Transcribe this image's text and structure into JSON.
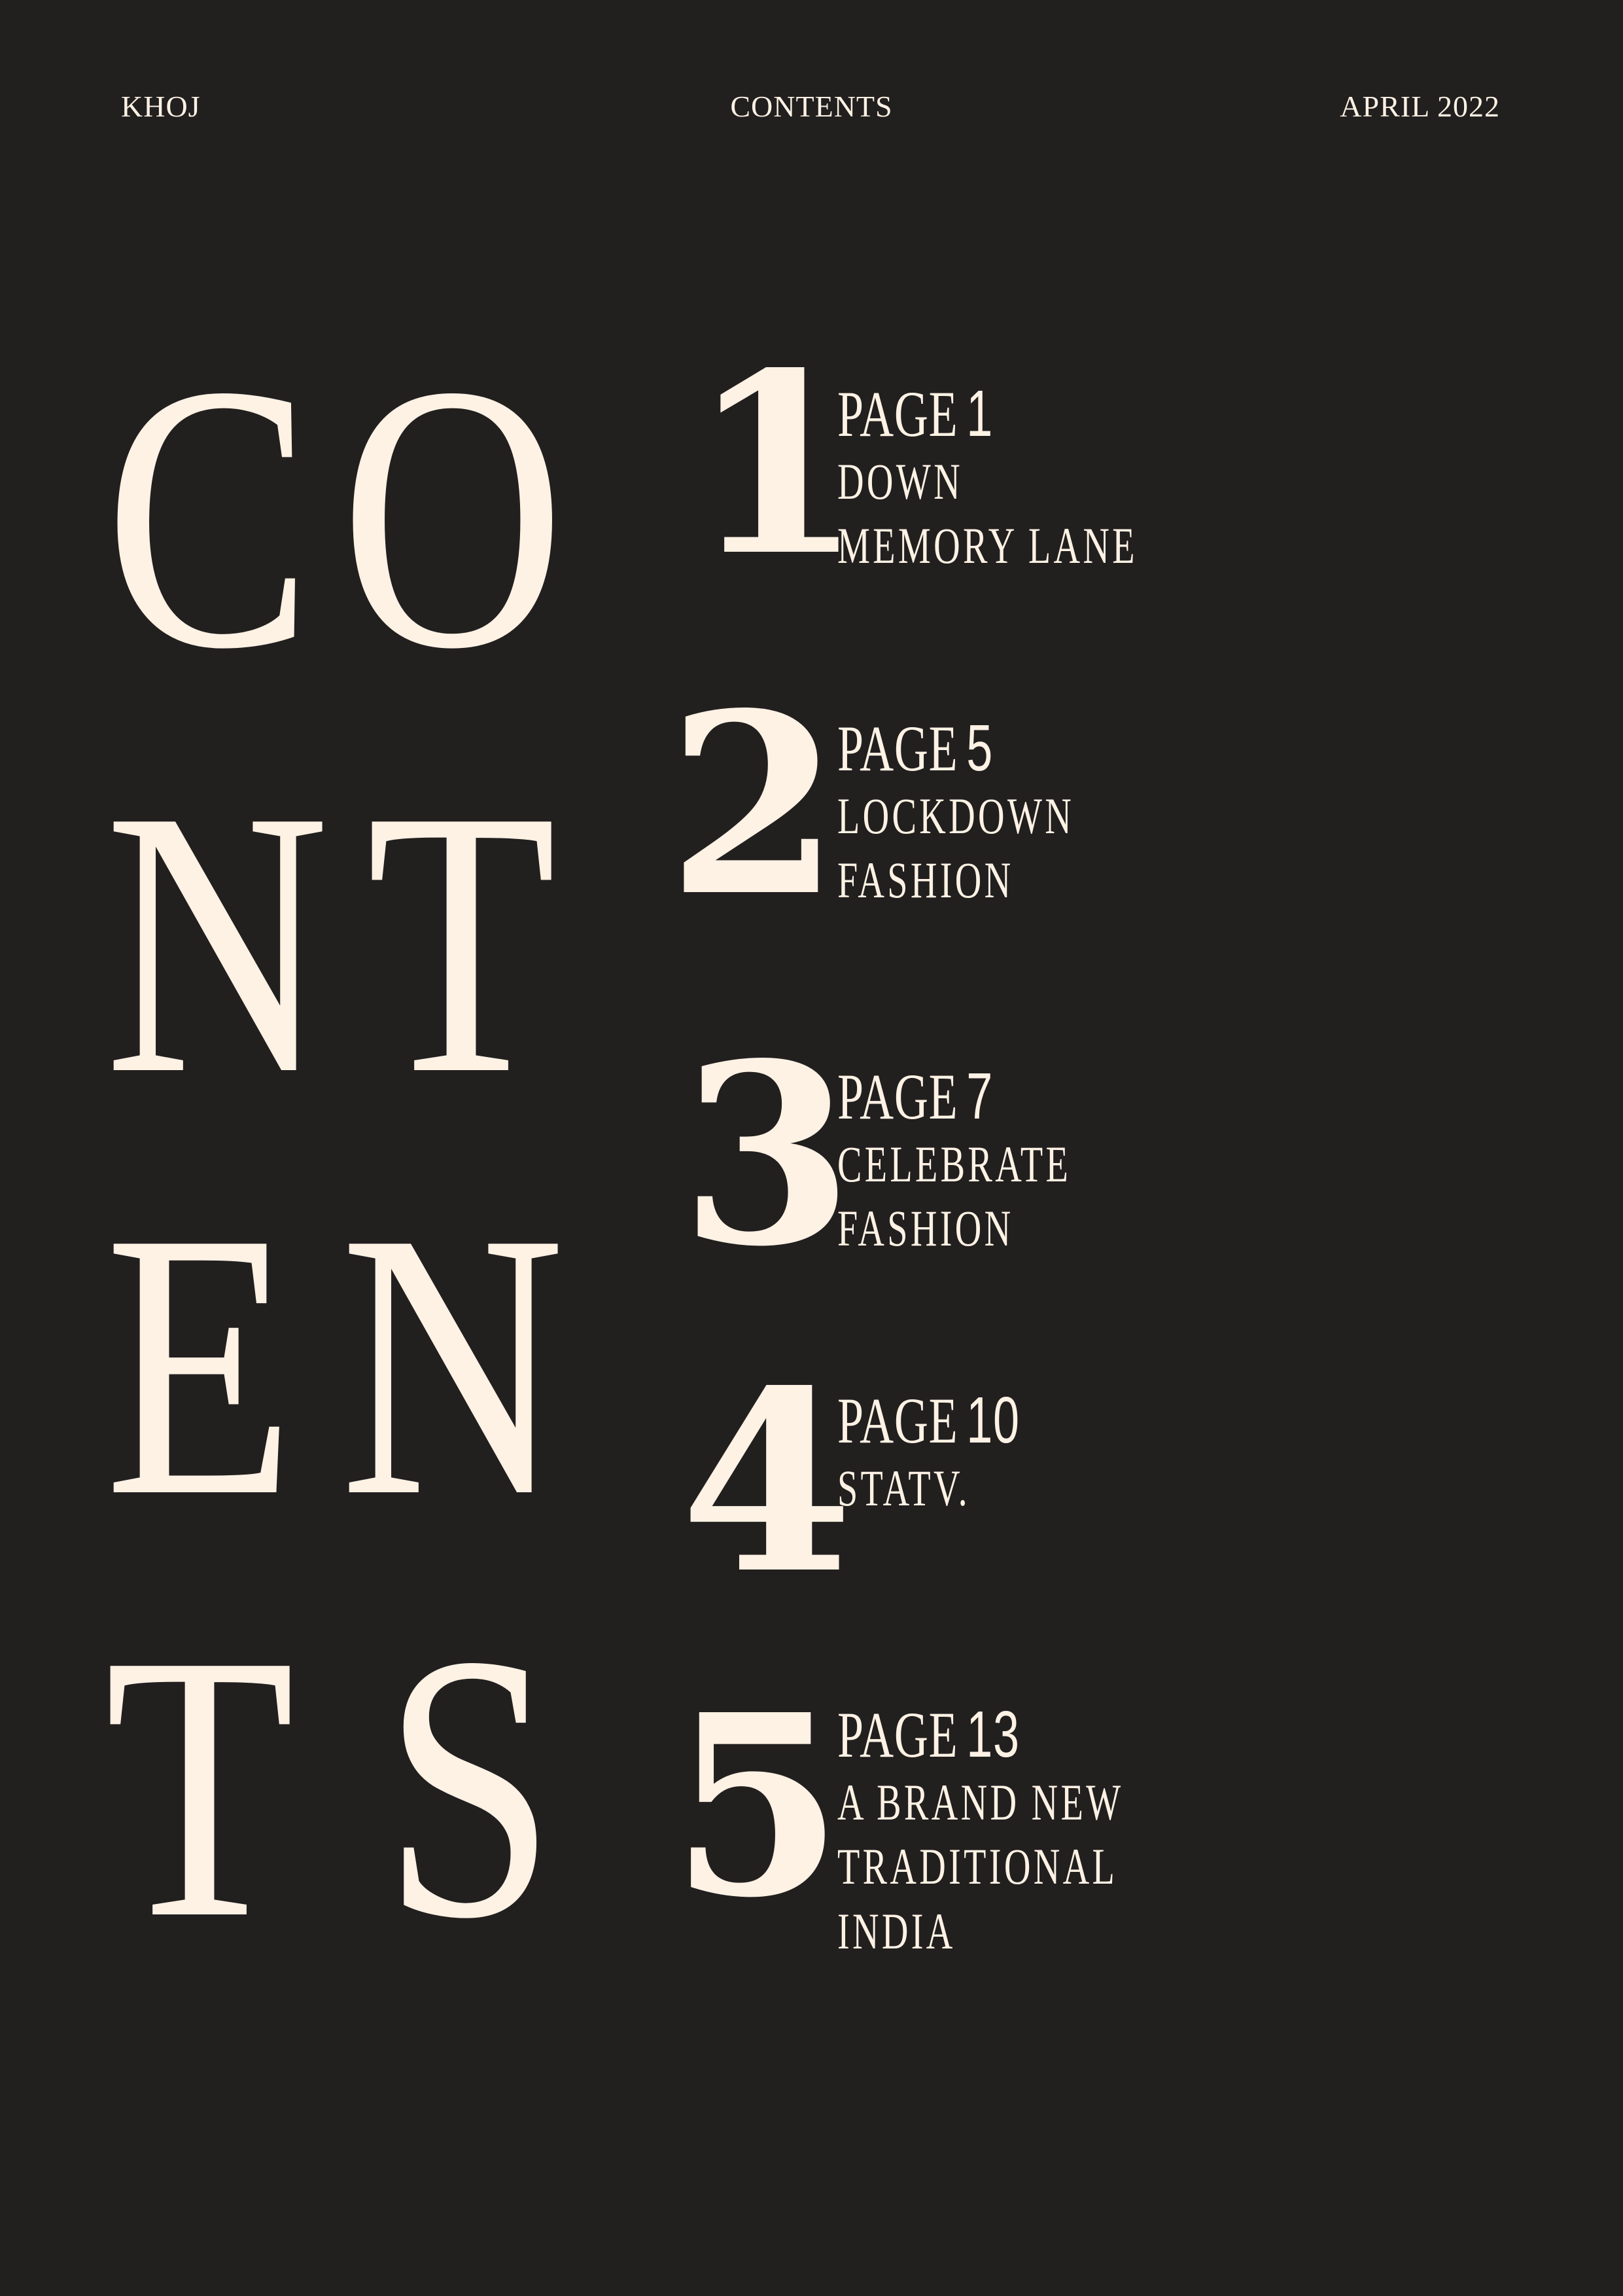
{
  "header": {
    "left": "KHOJ",
    "center": "CONTENTS",
    "right": "APRIL 2022"
  },
  "big_title": {
    "letters": [
      "C",
      "O",
      "N",
      "T",
      "E",
      "N",
      "T",
      "S"
    ]
  },
  "toc": [
    {
      "number": "1",
      "page_word": "PAGE",
      "page_number": "1",
      "title_lines": [
        "DOWN",
        "MEMORY LANE"
      ]
    },
    {
      "number": "2",
      "page_word": "PAGE",
      "page_number": "5",
      "title_lines": [
        "LOCKDOWN",
        "FASHION"
      ]
    },
    {
      "number": "3",
      "page_word": "PAGE",
      "page_number": "7",
      "title_lines": [
        "CELEBRATE",
        "FASHION"
      ]
    },
    {
      "number": "4",
      "page_word": "PAGE",
      "page_number": "10",
      "title_lines": [
        "STATV."
      ]
    },
    {
      "number": "5",
      "page_word": "PAGE",
      "page_number": "13",
      "title_lines": [
        "A BRAND NEW",
        "TRADITIONAL",
        "INDIA"
      ]
    }
  ]
}
